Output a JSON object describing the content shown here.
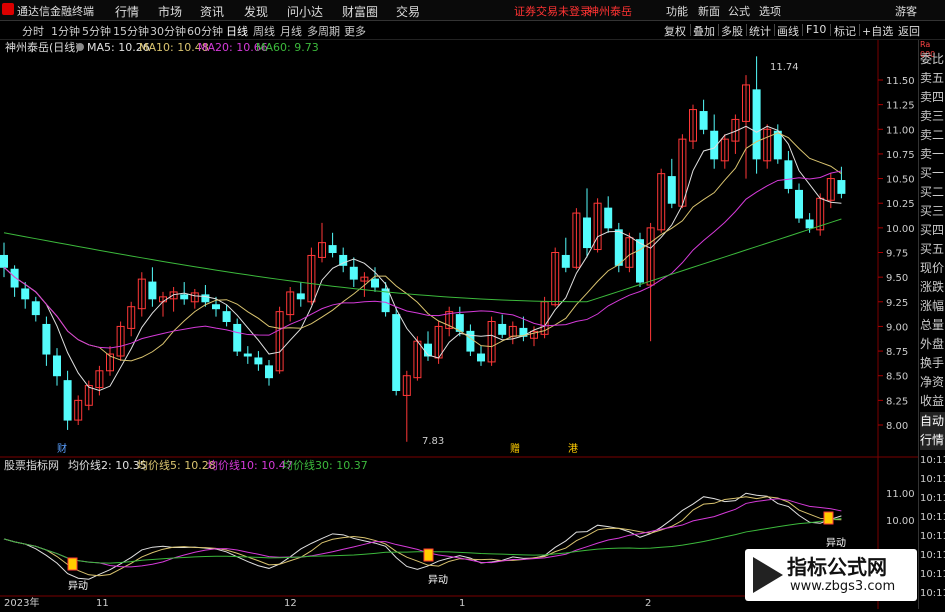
{
  "app": {
    "title": "通达信金融终端"
  },
  "menu": {
    "items": [
      "行情",
      "市场",
      "资讯",
      "发现",
      "问小达",
      "财富圈",
      "交易"
    ],
    "notice_login": "证券交易未登录",
    "notice_stock": "神州泰岳",
    "right": [
      "功能",
      "新面",
      "公式",
      "选项"
    ],
    "guest": "游客"
  },
  "periods": {
    "items": [
      "分时",
      "1分钟",
      "5分钟",
      "15分钟",
      "30分钟",
      "60分钟",
      "日线",
      "周线",
      "月线",
      "多周期",
      "更多"
    ],
    "active": "日线"
  },
  "tools": [
    "复权",
    "叠加",
    "多股",
    "统计",
    "画线",
    "F10",
    "标记",
    "+自选",
    "返回"
  ],
  "main": {
    "stock_label": "神州泰岳(日线)",
    "ma5": "MA5: 10.26",
    "ma10": "MA10: 10.48",
    "ma20": "MA20: 10.66",
    "ma60": "MA60: 9.73",
    "price_ticks": [
      "11.50",
      "11.25",
      "11.00",
      "10.75",
      "10.50",
      "10.25",
      "10.00",
      "9.75",
      "9.50",
      "9.25",
      "9.00",
      "8.75",
      "8.50",
      "8.25",
      "8.00"
    ],
    "high_label": "11.74",
    "low_label": "7.83",
    "marker_cai": "财",
    "marker_zeng": "赠",
    "marker_gang": "港"
  },
  "indicator": {
    "name": "股票指标网",
    "avg2": "均价线2: 10.35",
    "avg5": "均价线5: 10.28",
    "avg10": "均价线10: 10.47",
    "avg30": "均价线30: 10.37",
    "ticks": [
      "11.00",
      "10.00"
    ],
    "signal": "异动"
  },
  "time_axis": [
    "2023年",
    "11",
    "12",
    "1",
    "2"
  ],
  "right_panel": {
    "top": "Ra 000",
    "items": [
      "委比",
      "卖五",
      "卖四",
      "卖三",
      "卖二",
      "卖一",
      "买一",
      "买二",
      "买三",
      "买四",
      "买五",
      "现价",
      "涨跌",
      "涨幅",
      "总量",
      "外盘",
      "换手",
      "净资",
      "收益",
      "自动",
      "行情"
    ],
    "times": [
      "10:11",
      "10:11",
      "10:11",
      "10:11",
      "10:11",
      "10:11",
      "10:11",
      "10:11",
      "10:11"
    ]
  },
  "watermark": {
    "title": "指标公式网",
    "url": "www.zbgs3.com"
  },
  "colors": {
    "up": "#ff3838",
    "down": "#54fcfc",
    "ma5": "#e0e0e0",
    "ma10": "#d9c36f",
    "ma20": "#d53ad9",
    "ma60": "#3cb93c"
  },
  "chart_data": {
    "type": "candlestick",
    "ylim": [
      7.8,
      11.8
    ],
    "candles": [
      [
        9.72,
        9.85,
        9.5,
        9.6
      ],
      [
        9.58,
        9.62,
        9.3,
        9.4
      ],
      [
        9.38,
        9.45,
        9.18,
        9.28
      ],
      [
        9.25,
        9.3,
        9.05,
        9.12
      ],
      [
        9.02,
        9.1,
        8.6,
        8.72
      ],
      [
        8.7,
        8.78,
        8.4,
        8.5
      ],
      [
        8.45,
        8.55,
        7.95,
        8.05
      ],
      [
        8.05,
        8.3,
        8.0,
        8.25
      ],
      [
        8.2,
        8.45,
        8.15,
        8.4
      ],
      [
        8.38,
        8.6,
        8.3,
        8.55
      ],
      [
        8.55,
        8.8,
        8.5,
        8.72
      ],
      [
        8.7,
        9.05,
        8.65,
        9.0
      ],
      [
        8.98,
        9.25,
        8.9,
        9.2
      ],
      [
        9.18,
        9.55,
        9.1,
        9.48
      ],
      [
        9.45,
        9.6,
        9.2,
        9.28
      ],
      [
        9.25,
        9.35,
        9.1,
        9.3
      ],
      [
        9.28,
        9.4,
        9.15,
        9.35
      ],
      [
        9.32,
        9.45,
        9.22,
        9.28
      ],
      [
        9.25,
        9.38,
        9.18,
        9.34
      ],
      [
        9.32,
        9.42,
        9.2,
        9.25
      ],
      [
        9.22,
        9.3,
        9.1,
        9.18
      ],
      [
        9.15,
        9.22,
        9.0,
        9.05
      ],
      [
        9.02,
        9.08,
        8.7,
        8.75
      ],
      [
        8.72,
        8.8,
        8.62,
        8.7
      ],
      [
        8.68,
        8.75,
        8.55,
        8.62
      ],
      [
        8.6,
        8.66,
        8.4,
        8.48
      ],
      [
        8.55,
        9.2,
        8.52,
        9.15
      ],
      [
        9.12,
        9.4,
        9.05,
        9.35
      ],
      [
        9.33,
        9.45,
        9.2,
        9.28
      ],
      [
        9.25,
        9.8,
        9.22,
        9.72
      ],
      [
        9.7,
        10.05,
        9.65,
        9.85
      ],
      [
        9.82,
        9.95,
        9.7,
        9.75
      ],
      [
        9.72,
        9.8,
        9.55,
        9.62
      ],
      [
        9.6,
        9.7,
        9.4,
        9.48
      ],
      [
        9.46,
        9.55,
        9.3,
        9.5
      ],
      [
        9.48,
        9.6,
        9.35,
        9.4
      ],
      [
        9.38,
        9.45,
        9.1,
        9.15
      ],
      [
        9.12,
        9.2,
        8.3,
        8.35
      ],
      [
        8.3,
        8.55,
        7.83,
        8.5
      ],
      [
        8.48,
        8.9,
        8.45,
        8.85
      ],
      [
        8.82,
        8.95,
        8.65,
        8.7
      ],
      [
        8.68,
        9.05,
        8.62,
        9.0
      ],
      [
        8.98,
        9.2,
        8.9,
        9.15
      ],
      [
        9.12,
        9.2,
        8.9,
        8.95
      ],
      [
        8.95,
        9.02,
        8.7,
        8.75
      ],
      [
        8.72,
        8.8,
        8.6,
        8.65
      ],
      [
        8.64,
        9.1,
        8.6,
        9.05
      ],
      [
        9.02,
        9.12,
        8.88,
        8.92
      ],
      [
        8.9,
        9.05,
        8.82,
        9.0
      ],
      [
        8.98,
        9.1,
        8.85,
        8.9
      ],
      [
        8.88,
        9.0,
        8.8,
        8.95
      ],
      [
        8.92,
        9.3,
        8.88,
        9.25
      ],
      [
        9.22,
        9.8,
        9.2,
        9.75
      ],
      [
        9.72,
        9.9,
        9.55,
        9.6
      ],
      [
        9.6,
        10.2,
        9.58,
        10.15
      ],
      [
        10.1,
        10.4,
        9.7,
        9.8
      ],
      [
        9.78,
        10.3,
        9.75,
        10.25
      ],
      [
        10.2,
        10.32,
        9.95,
        10.0
      ],
      [
        9.98,
        10.05,
        9.55,
        9.62
      ],
      [
        9.6,
        9.95,
        9.55,
        9.9
      ],
      [
        9.88,
        9.95,
        9.4,
        9.45
      ],
      [
        9.42,
        10.05,
        8.85,
        10.0
      ],
      [
        9.98,
        10.6,
        9.95,
        10.55
      ],
      [
        10.52,
        10.7,
        10.2,
        10.25
      ],
      [
        10.22,
        10.95,
        10.2,
        10.9
      ],
      [
        10.88,
        11.25,
        10.8,
        11.2
      ],
      [
        11.18,
        11.3,
        10.95,
        11.0
      ],
      [
        10.98,
        11.15,
        10.6,
        10.7
      ],
      [
        10.68,
        10.95,
        10.6,
        10.9
      ],
      [
        10.88,
        11.15,
        10.75,
        11.1
      ],
      [
        11.08,
        11.55,
        10.5,
        11.45
      ],
      [
        11.4,
        11.74,
        10.55,
        10.7
      ],
      [
        10.68,
        11.05,
        10.6,
        11.0
      ],
      [
        10.98,
        11.05,
        10.65,
        10.7
      ],
      [
        10.68,
        10.78,
        10.35,
        10.4
      ],
      [
        10.38,
        10.45,
        10.05,
        10.1
      ],
      [
        10.08,
        10.15,
        9.95,
        10.0
      ],
      [
        9.98,
        10.35,
        9.92,
        10.3
      ],
      [
        10.28,
        10.55,
        10.2,
        10.5
      ],
      [
        10.48,
        10.62,
        10.3,
        10.35
      ]
    ]
  }
}
